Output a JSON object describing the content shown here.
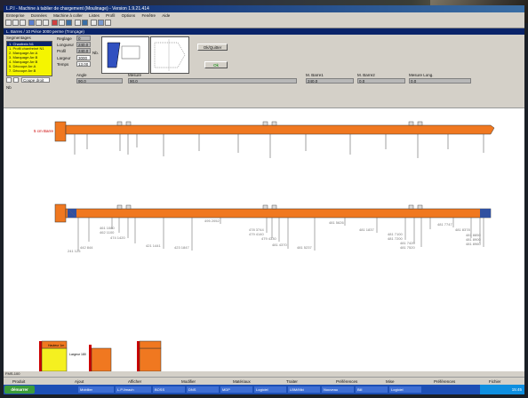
{
  "window": {
    "title": "L.P.I - Machine à tablier de chargement (Moulinage) - Version 1.9.21.414",
    "subtitle": "L. Barres / 10 Pièce 3000 perme (Tronçage)"
  },
  "menu": [
    "Entreprise",
    "Données",
    "Machine à coller",
    "Listes",
    "Profil",
    "Options",
    "Fenêtre",
    "Aide"
  ],
  "params": {
    "list_title": "Segmentages",
    "items": [
      "1. Chanfrein N1",
      "1. Profil chanfreiné N1",
      "2. Marquage Arr.A",
      "3. Marquage Arr.B",
      "4. Marquage Arr.B",
      "5. Découpe Arr.A",
      "7. Découpe Arr.B"
    ],
    "labels": {
      "reglage": "Reglage",
      "longueur": "Longueur",
      "profil": "Profil",
      "largeur": "Largeur",
      "temps": "Temps",
      "angle": "Angle",
      "nb": "Nb",
      "mesure": "Mesure"
    },
    "values": {
      "reglage": "0",
      "longueur": "240.0",
      "profil": "240.0",
      "largeur": "3000",
      "temps": "13.00",
      "angle": "90.0",
      "mesure": "90.0"
    },
    "tool_label": "Coupe droit",
    "button_1": "Ok/Quitter",
    "button_2": "Ok",
    "mesure_labels": [
      "M. Barre1",
      "M. Barre2",
      "Mesure Long."
    ],
    "mesure_values": [
      "240.0",
      "0.0",
      "0.0"
    ]
  },
  "drawing": {
    "top_bar_label": "5 cm Barre",
    "bottom_labels": [
      "241 125",
      "442 844",
      "461 1080",
      "462 1100",
      "474 1420",
      "421 1441",
      "423 1847",
      "495 2052",
      "478 3744",
      "479 4140",
      "479 4330",
      "481 4370",
      "481 5237",
      "481 5626",
      "481 1837",
      "481 7100",
      "481 7200",
      "481 7420",
      "481 7520",
      "481 7747",
      "481 8378",
      "481 8850",
      "481 8900",
      "481 8960"
    ]
  },
  "boxes": [
    {
      "label": "Hauteur 1m",
      "sub": "Largeur 180"
    },
    {
      "label": "",
      "sub": ""
    },
    {
      "label": "",
      "sub": ""
    }
  ],
  "status": "FMS-100",
  "tabs": [
    "Produit",
    "Ajout",
    "Afficher",
    "Modifier",
    "Matériaux",
    "Traiter",
    "Préférences",
    "Mise",
    "Préférences",
    "Fichier"
  ],
  "taskbar": {
    "start": "démarrer",
    "tasks": [
      "Mobilier",
      "L.P.I/mach",
      "BOSS",
      "DNS",
      "MDP",
      "Logiciel",
      "LBM/Mkt",
      "Nouveau",
      "Bill",
      "Logiciel"
    ],
    "clock": "15:45"
  }
}
